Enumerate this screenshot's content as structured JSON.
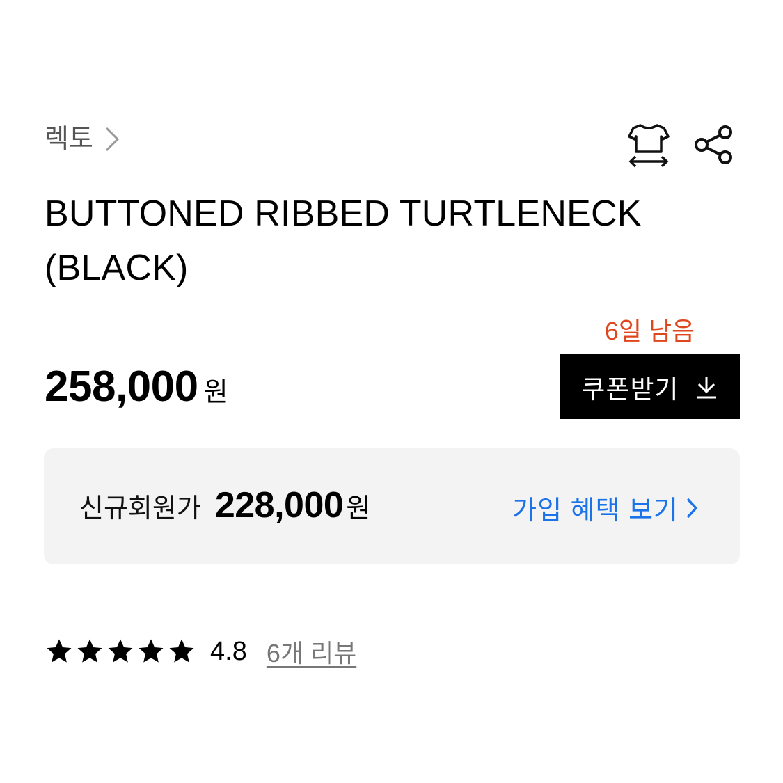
{
  "breadcrumb": {
    "brand": "렉토"
  },
  "icons": {
    "size_guide": "tshirt-size-icon",
    "share": "share-icon"
  },
  "product": {
    "title_line1": "BUTTONED RIBBED TURTLENECK",
    "title_line2": "(BLACK)",
    "price": "258,000",
    "price_unit": "원"
  },
  "coupon": {
    "days_left": "6일 남음",
    "button_label": "쿠폰받기",
    "accent_color": "#e0461d"
  },
  "member": {
    "label": "신규회원가",
    "price": "228,000",
    "unit": "원",
    "benefit_link": "가입 혜택 보기",
    "link_color": "#1a73e8"
  },
  "rating": {
    "stars": 5,
    "value": "4.8",
    "review_link": "6개 리뷰"
  }
}
